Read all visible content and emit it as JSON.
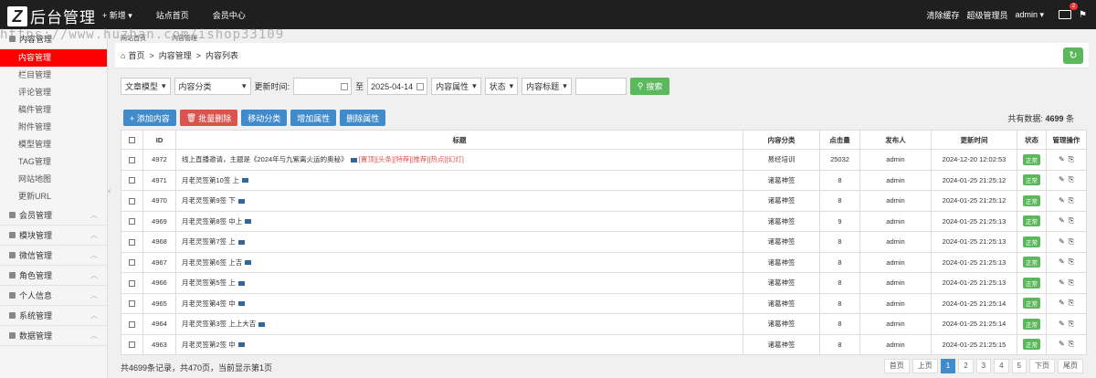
{
  "brand": {
    "logo_letter": "Z",
    "title": "后台管理"
  },
  "nav": {
    "new_label": "+ 新增 ▾",
    "home_label": "站点首页",
    "member_label": "会员中心"
  },
  "user": {
    "clear_cache": "清除缓存",
    "role": "超级管理员",
    "username": "admin ▾",
    "mail_count": "2"
  },
  "watermark": "https://www.huzhan.com/ishop33109",
  "tabs": [
    "网站首页",
    "内容管理"
  ],
  "sidebar": {
    "groups": [
      {
        "label": "内容管理"
      },
      {
        "label": "会员管理"
      },
      {
        "label": "模块管理"
      },
      {
        "label": "微信管理"
      },
      {
        "label": "角色管理"
      },
      {
        "label": "个人信息"
      },
      {
        "label": "系统管理"
      },
      {
        "label": "数据管理"
      }
    ],
    "items": [
      "内容管理",
      "栏目管理",
      "评论管理",
      "稿件管理",
      "附件管理",
      "模型管理",
      "TAG管理",
      "网站地图",
      "更新URL"
    ]
  },
  "breadcrumb": "首页  >  内容管理  >  内容列表",
  "filter": {
    "model": "文章模型",
    "category": "内容分类",
    "update_label": "更新时间:",
    "date_from": "",
    "to_label": "至",
    "date_to": "2025-04-14",
    "attr": "内容属性",
    "status": "状态",
    "title_sel": "内容标题",
    "keyword": "",
    "search": "搜索"
  },
  "actions": {
    "add": "+ 添加内容",
    "batch_delete": "批量删除",
    "move": "移动分类",
    "add_attr": "增加属性",
    "del_attr": "删除属性"
  },
  "total": {
    "label": "共有数据:",
    "count": "4699",
    "unit": "条"
  },
  "table": {
    "headers": [
      "ID",
      "标题",
      "内容分类",
      "点击量",
      "发布人",
      "更新时间",
      "状态",
      "管理操作"
    ],
    "rows": [
      {
        "id": "4972",
        "title": "线上直播邀请，主题是《2024年与九紫离火运的奥秘》",
        "flags": "[置顶][头条][特荐][推荐][热点][幻灯]",
        "cat": "易经培训",
        "clicks": "25032",
        "author": "admin",
        "time": "2024-12-20 12:02:53",
        "status": "正常"
      },
      {
        "id": "4971",
        "title": "月老灵签第10签 上",
        "flags": "",
        "cat": "诸葛神签",
        "clicks": "8",
        "author": "admin",
        "time": "2024-01-25 21:25:12",
        "status": "正常"
      },
      {
        "id": "4970",
        "title": "月老灵签第9签 下",
        "flags": "",
        "cat": "诸葛神签",
        "clicks": "8",
        "author": "admin",
        "time": "2024-01-25 21:25:12",
        "status": "正常"
      },
      {
        "id": "4969",
        "title": "月老灵签第8签 中上",
        "flags": "",
        "cat": "诸葛神签",
        "clicks": "9",
        "author": "admin",
        "time": "2024-01-25 21:25:13",
        "status": "正常"
      },
      {
        "id": "4968",
        "title": "月老灵签第7签 上",
        "flags": "",
        "cat": "诸葛神签",
        "clicks": "8",
        "author": "admin",
        "time": "2024-01-25 21:25:13",
        "status": "正常"
      },
      {
        "id": "4967",
        "title": "月老灵签第6签 上吉",
        "flags": "",
        "cat": "诸葛神签",
        "clicks": "8",
        "author": "admin",
        "time": "2024-01-25 21:25:13",
        "status": "正常"
      },
      {
        "id": "4966",
        "title": "月老灵签第5签 上",
        "flags": "",
        "cat": "诸葛神签",
        "clicks": "8",
        "author": "admin",
        "time": "2024-01-25 21:25:13",
        "status": "正常"
      },
      {
        "id": "4965",
        "title": "月老灵签第4签 中",
        "flags": "",
        "cat": "诸葛神签",
        "clicks": "8",
        "author": "admin",
        "time": "2024-01-25 21:25:14",
        "status": "正常"
      },
      {
        "id": "4964",
        "title": "月老灵签第3签 上上大吉",
        "flags": "",
        "cat": "诸葛神签",
        "clicks": "8",
        "author": "admin",
        "time": "2024-01-25 21:25:14",
        "status": "正常"
      },
      {
        "id": "4963",
        "title": "月老灵签第2签 中",
        "flags": "",
        "cat": "诸葛神签",
        "clicks": "8",
        "author": "admin",
        "time": "2024-01-25 21:25:15",
        "status": "正常"
      }
    ]
  },
  "footer": {
    "info": "共4699条记录，共470页，当前显示第1页"
  },
  "pager": [
    "首页",
    "上页",
    "1",
    "2",
    "3",
    "4",
    "5",
    "下页",
    "尾页"
  ],
  "colors": {
    "topbar": "#1f1f1f",
    "active": "#ff0000",
    "primary": "#428bca",
    "success": "#5cb85c",
    "danger": "#d9534f"
  }
}
